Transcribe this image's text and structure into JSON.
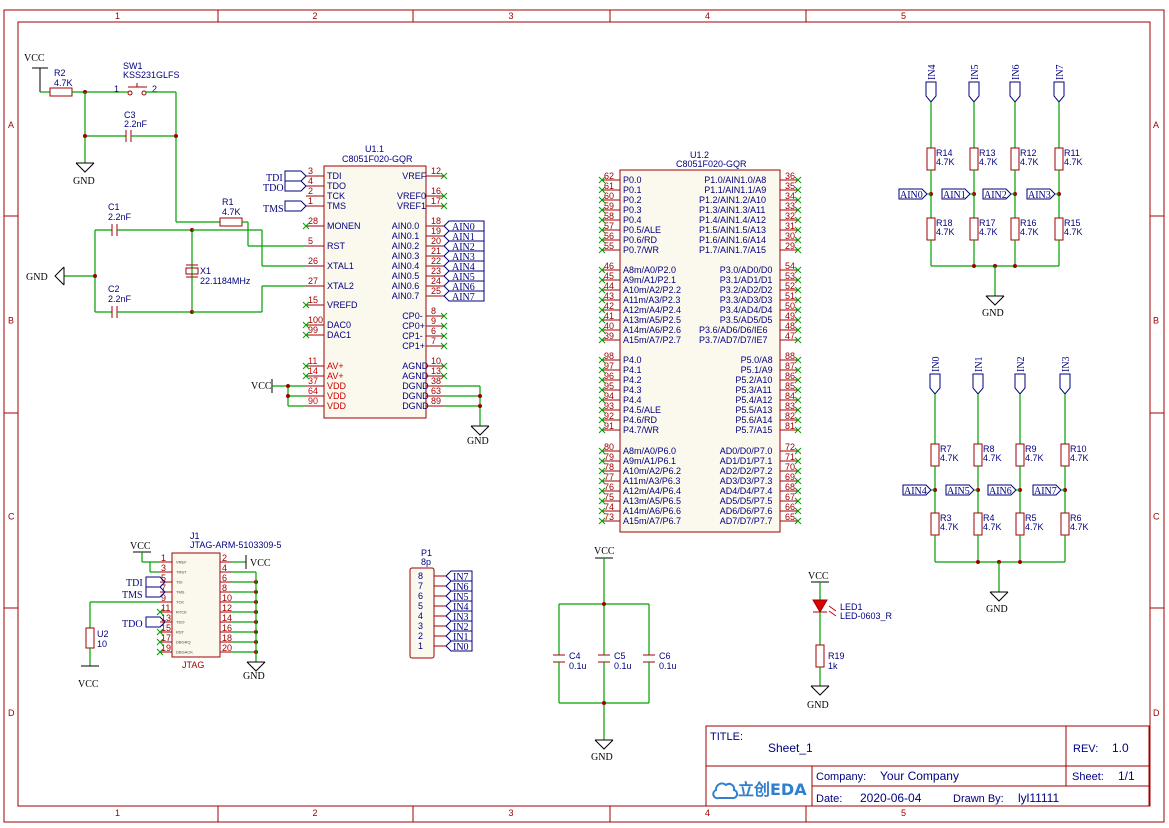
{
  "grid": {
    "columns": [
      "1",
      "2",
      "3",
      "4",
      "5"
    ],
    "rows": [
      "A",
      "B",
      "C",
      "D"
    ]
  },
  "nets": {
    "vcc": "VCC",
    "gnd": "GND",
    "tdi": "TDI",
    "tdo": "TDO",
    "tck": "TCK",
    "tms": "TMS"
  },
  "components": {
    "r2": {
      "ref": "R2",
      "value": "4.7K"
    },
    "sw1": {
      "ref": "SW1",
      "value": "KSS231GLFS",
      "pin1": "1",
      "pin2": "2"
    },
    "c3": {
      "ref": "C3",
      "value": "2.2nF"
    },
    "r1": {
      "ref": "R1",
      "value": "4.7K"
    },
    "c1": {
      "ref": "C1",
      "value": "2.2nF"
    },
    "c2": {
      "ref": "C2",
      "value": "2.2nF"
    },
    "x1": {
      "ref": "X1",
      "value": "22.1184MHz"
    },
    "u11": {
      "ref": "U1.1",
      "value": "C8051F020-GQR"
    },
    "u12": {
      "ref": "U1.2",
      "value": "C8051F020-GQR"
    },
    "j1": {
      "ref": "J1",
      "value": "JTAG-ARM-5103309-5",
      "footer": "JTAG"
    },
    "u2": {
      "ref": "U2",
      "value": "10"
    },
    "p1": {
      "ref": "P1",
      "value": "8p"
    },
    "c4": {
      "ref": "C4",
      "value": "0.1u"
    },
    "c5": {
      "ref": "C5",
      "value": "0.1u"
    },
    "c6": {
      "ref": "C6",
      "value": "0.1u"
    },
    "led1": {
      "ref": "LED1",
      "value": "LED-0603_R"
    },
    "r19": {
      "ref": "R19",
      "value": "1k"
    }
  },
  "u11_left_pins": [
    {
      "num": "3",
      "name": "TDI"
    },
    {
      "num": "4",
      "name": "TDO"
    },
    {
      "num": "2",
      "name": "TCK"
    },
    {
      "num": "1",
      "name": "TMS"
    },
    {
      "num": "28",
      "name": "MONEN"
    },
    {
      "num": "5",
      "name": "RST"
    },
    {
      "num": "26",
      "name": "XTAL1"
    },
    {
      "num": "27",
      "name": "XTAL2"
    },
    {
      "num": "15",
      "name": "VREFD"
    },
    {
      "num": "100",
      "name": "DAC0"
    },
    {
      "num": "99",
      "name": "DAC1"
    },
    {
      "num": "11",
      "name": "AV+"
    },
    {
      "num": "14",
      "name": "AV+"
    },
    {
      "num": "37",
      "name": "VDD"
    },
    {
      "num": "64",
      "name": "VDD"
    },
    {
      "num": "90",
      "name": "VDD"
    }
  ],
  "u11_right_pins": [
    {
      "num": "12",
      "name": "VREF"
    },
    {
      "num": "16",
      "name": "VREF0"
    },
    {
      "num": "17",
      "name": "VREF1"
    },
    {
      "num": "18",
      "name": "AIN0.0"
    },
    {
      "num": "19",
      "name": "AIN0.1"
    },
    {
      "num": "20",
      "name": "AIN0.2"
    },
    {
      "num": "21",
      "name": "AIN0.3"
    },
    {
      "num": "22",
      "name": "AIN0.4"
    },
    {
      "num": "23",
      "name": "AIN0.5"
    },
    {
      "num": "24",
      "name": "AIN0.6"
    },
    {
      "num": "25",
      "name": "AIN0.7"
    },
    {
      "num": "8",
      "name": "CP0-"
    },
    {
      "num": "9",
      "name": "CP0+"
    },
    {
      "num": "6",
      "name": "CP1-"
    },
    {
      "num": "7",
      "name": "CP1+"
    },
    {
      "num": "10",
      "name": "AGND"
    },
    {
      "num": "13",
      "name": "AGND"
    },
    {
      "num": "38",
      "name": "DGND"
    },
    {
      "num": "63",
      "name": "DGND"
    },
    {
      "num": "89",
      "name": "DGND"
    }
  ],
  "ain_flags": [
    "AIN0",
    "AIN1",
    "AIN2",
    "AIN3",
    "AIN4",
    "AIN5",
    "AIN6",
    "AIN7"
  ],
  "u12_left_groups": [
    [
      {
        "num": "62",
        "name": "P0.0"
      },
      {
        "num": "61",
        "name": "P0.1"
      },
      {
        "num": "60",
        "name": "P0.2"
      },
      {
        "num": "59",
        "name": "P0.3"
      },
      {
        "num": "58",
        "name": "P0.4"
      },
      {
        "num": "57",
        "name": "P0.5/ALE"
      },
      {
        "num": "56",
        "name": "P0.6/RD"
      },
      {
        "num": "55",
        "name": "P0.7/WR"
      }
    ],
    [
      {
        "num": "46",
        "name": "A8m/A0/P2.0"
      },
      {
        "num": "45",
        "name": "A9m/A1/P2.1"
      },
      {
        "num": "44",
        "name": "A10m/A2/P2.2"
      },
      {
        "num": "43",
        "name": "A11m/A3/P2.3"
      },
      {
        "num": "42",
        "name": "A12m/A4/P2.4"
      },
      {
        "num": "41",
        "name": "A13m/A5/P2.5"
      },
      {
        "num": "40",
        "name": "A14m/A6/P2.6"
      },
      {
        "num": "39",
        "name": "A15m/A7/P2.7"
      }
    ],
    [
      {
        "num": "98",
        "name": "P4.0"
      },
      {
        "num": "97",
        "name": "P4.1"
      },
      {
        "num": "96",
        "name": "P4.2"
      },
      {
        "num": "95",
        "name": "P4.3"
      },
      {
        "num": "94",
        "name": "P4.4"
      },
      {
        "num": "93",
        "name": "P4.5/ALE"
      },
      {
        "num": "92",
        "name": "P4.6/RD"
      },
      {
        "num": "91",
        "name": "P4.7/WR"
      }
    ],
    [
      {
        "num": "80",
        "name": "A8m/A0/P6.0"
      },
      {
        "num": "79",
        "name": "A9m/A1/P6.1"
      },
      {
        "num": "78",
        "name": "A10m/A2/P6.2"
      },
      {
        "num": "77",
        "name": "A11m/A3/P6.3"
      },
      {
        "num": "76",
        "name": "A12m/A4/P6.4"
      },
      {
        "num": "75",
        "name": "A13m/A5/P6.5"
      },
      {
        "num": "74",
        "name": "A14m/A6/P6.6"
      },
      {
        "num": "73",
        "name": "A15m/A7/P6.7"
      }
    ]
  ],
  "u12_right_groups": [
    [
      {
        "num": "36",
        "name": "P1.0/AIN1.0/A8"
      },
      {
        "num": "35",
        "name": "P1.1/AIN1.1/A9"
      },
      {
        "num": "34",
        "name": "P1.2/AIN1.2/A10"
      },
      {
        "num": "33",
        "name": "P1.3/AIN1.3/A11"
      },
      {
        "num": "32",
        "name": "P1.4/AIN1.4/A12"
      },
      {
        "num": "31",
        "name": "P1.5/AIN1.5/A13"
      },
      {
        "num": "30",
        "name": "P1.6/AIN1.6/A14"
      },
      {
        "num": "29",
        "name": "P1.7/AIN1.7/A15"
      }
    ],
    [
      {
        "num": "54",
        "name": "P3.0/AD0/D0"
      },
      {
        "num": "53",
        "name": "P3.1/AD1/D1"
      },
      {
        "num": "52",
        "name": "P3.2/AD2/D2"
      },
      {
        "num": "51",
        "name": "P3.3/AD3/D3"
      },
      {
        "num": "50",
        "name": "P3.4/AD4/D4"
      },
      {
        "num": "49",
        "name": "P3.5/AD5/D5"
      },
      {
        "num": "48",
        "name": "P3.6/AD6/D6/IE6"
      },
      {
        "num": "47",
        "name": "P3.7/AD7/D7/IE7"
      }
    ],
    [
      {
        "num": "88",
        "name": "P5.0/A8"
      },
      {
        "num": "87",
        "name": "P5.1/A9"
      },
      {
        "num": "86",
        "name": "P5.2/A10"
      },
      {
        "num": "85",
        "name": "P5.3/A11"
      },
      {
        "num": "84",
        "name": "P5.4/A12"
      },
      {
        "num": "83",
        "name": "P5.5/A13"
      },
      {
        "num": "82",
        "name": "P5.6/A14"
      },
      {
        "num": "81",
        "name": "P5.7/A15"
      }
    ],
    [
      {
        "num": "72",
        "name": "AD0/D0/P7.0"
      },
      {
        "num": "71",
        "name": "AD1/D1/P7.1"
      },
      {
        "num": "70",
        "name": "AD2/D2/P7.2"
      },
      {
        "num": "69",
        "name": "AD3/D3/P7.3"
      },
      {
        "num": "68",
        "name": "AD4/D4/P7.4"
      },
      {
        "num": "67",
        "name": "AD5/D5/P7.5"
      },
      {
        "num": "66",
        "name": "AD6/D6/P7.6"
      },
      {
        "num": "65",
        "name": "AD7/D7/P7.7"
      }
    ]
  ],
  "j1_left_pins": [
    "1",
    "3",
    "5",
    "7",
    "9",
    "11",
    "13",
    "15",
    "17",
    "19"
  ],
  "j1_right_pins": [
    "2",
    "4",
    "6",
    "8",
    "10",
    "12",
    "14",
    "16",
    "18",
    "20"
  ],
  "j1_inner_labels": [
    "VREF",
    "TRST",
    "TDI",
    "TMS",
    "TCK",
    "RTCK",
    "TDO",
    "RST",
    "DBGRQ",
    "DBGACK"
  ],
  "p1_pins": [
    "8",
    "7",
    "6",
    "5",
    "4",
    "3",
    "2",
    "1"
  ],
  "p1_nets": [
    "IN7",
    "IN6",
    "IN5",
    "IN4",
    "IN3",
    "IN2",
    "IN1",
    "IN0"
  ],
  "top_dividers": [
    {
      "net": "IN4",
      "rtop": "R14",
      "rbot": "R18",
      "ain": "AIN0",
      "value": "4.7K"
    },
    {
      "net": "IN5",
      "rtop": "R13",
      "rbot": "R17",
      "ain": "AIN1",
      "value": "4.7K"
    },
    {
      "net": "IN6",
      "rtop": "R12",
      "rbot": "R16",
      "ain": "AIN2",
      "value": "4.7K"
    },
    {
      "net": "IN7",
      "rtop": "R11",
      "rbot": "R15",
      "ain": "AIN3",
      "value": "4.7K"
    }
  ],
  "bottom_dividers": [
    {
      "net": "IN0",
      "rtop": "R7",
      "rbot": "R3",
      "ain": "AIN4",
      "value": "4.7K"
    },
    {
      "net": "IN1",
      "rtop": "R8",
      "rbot": "R4",
      "ain": "AIN5",
      "value": "4.7K"
    },
    {
      "net": "IN2",
      "rtop": "R9",
      "rbot": "R5",
      "ain": "AIN6",
      "value": "4.7K"
    },
    {
      "net": "IN3",
      "rtop": "R10",
      "rbot": "R6",
      "ain": "AIN7",
      "value": "4.7K"
    }
  ],
  "title_block": {
    "title_label": "TITLE:",
    "title": "Sheet_1",
    "rev_label": "REV:",
    "rev": "1.0",
    "company_label": "Company:",
    "company": "Your Company",
    "sheet_label": "Sheet:",
    "sheet": "1/1",
    "date_label": "Date:",
    "date": "2020-06-04",
    "drawn_label": "Drawn By:",
    "drawn_by": "lyl11111",
    "logo": "立创EDA"
  },
  "colors": {
    "wire": "#00a000",
    "body": "#a00000",
    "label": "#000080",
    "power_pin": "#cc0000"
  }
}
